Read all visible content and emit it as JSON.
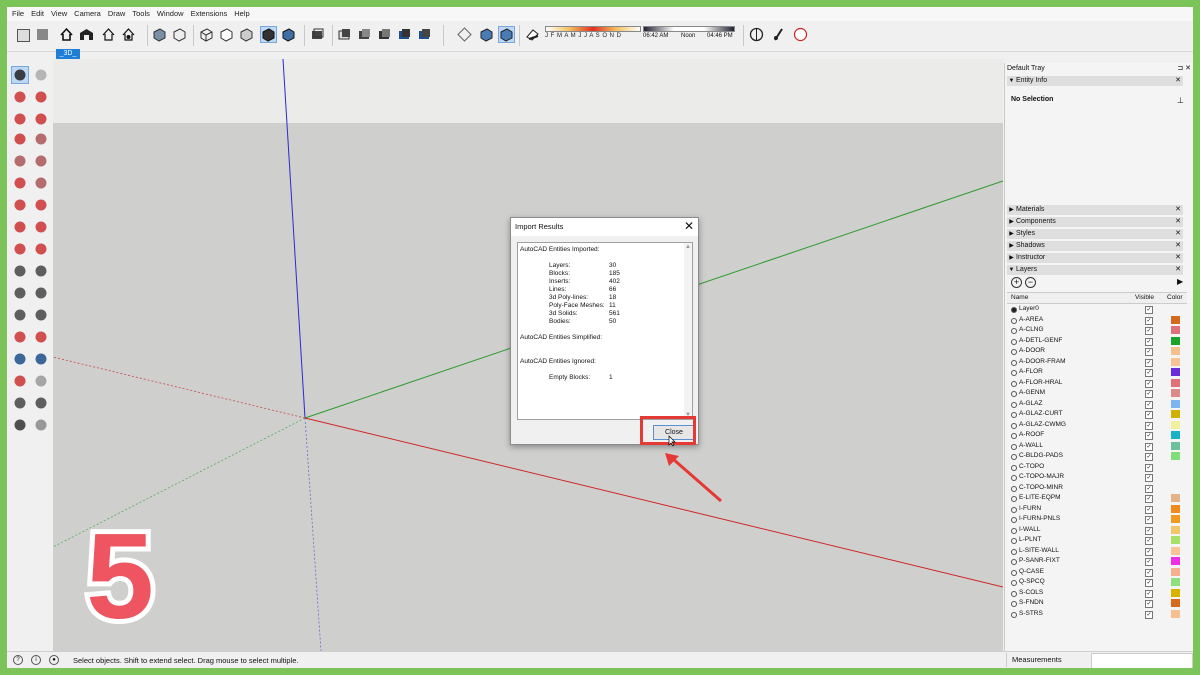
{
  "menu": [
    "File",
    "Edit",
    "View",
    "Camera",
    "Draw",
    "Tools",
    "Window",
    "Extensions",
    "Help"
  ],
  "shadow_months": "J F M A M J J A S O N D",
  "shadow_times": {
    "start": "06:42 AM",
    "mid": "Noon",
    "end": "04:46 PM"
  },
  "scene_tab": "_3D_",
  "dialog": {
    "title": "Import Results",
    "imported_heading": "AutoCAD Entities Imported:",
    "imported": [
      {
        "name": "Layers:",
        "value": "30"
      },
      {
        "name": "Blocks:",
        "value": "185"
      },
      {
        "name": "Inserts:",
        "value": "402"
      },
      {
        "name": "Lines:",
        "value": "66"
      },
      {
        "name": "3d Poly-lines:",
        "value": "18"
      },
      {
        "name": "Poly-Face Meshes:",
        "value": "11"
      },
      {
        "name": "3d Solids:",
        "value": "561"
      },
      {
        "name": "Bodies:",
        "value": "50"
      }
    ],
    "simplified_heading": "AutoCAD Entities Simplified:",
    "ignored_heading": "AutoCAD Entities Ignored:",
    "ignored": [
      {
        "name": "Empty Blocks:",
        "value": "1"
      }
    ],
    "close_label": "Close",
    "close_x": "✕"
  },
  "overlay_number": "5",
  "tray": {
    "title": "Default Tray",
    "entity_info_label": "Entity Info",
    "no_selection": "No Selection",
    "panels": [
      "Materials",
      "Components",
      "Styles",
      "Shadows",
      "Instructor"
    ],
    "layers_label": "Layers",
    "columns": {
      "name": "Name",
      "visible": "Visible",
      "color": "Color"
    },
    "layers": [
      {
        "name": "Layer0",
        "active": true,
        "color": ""
      },
      {
        "name": "A-AREA",
        "active": false,
        "color": "#d5691e"
      },
      {
        "name": "A-CLNG",
        "active": false,
        "color": "#e2707a"
      },
      {
        "name": "A-DETL-GENF",
        "active": false,
        "color": "#1aa32a"
      },
      {
        "name": "A-DOOR",
        "active": false,
        "color": "#f4c08c"
      },
      {
        "name": "A-DOOR-FRAM",
        "active": false,
        "color": "#f6c495"
      },
      {
        "name": "A-FLOR",
        "active": false,
        "color": "#6a2bd8"
      },
      {
        "name": "A-FLOR-HRAL",
        "active": false,
        "color": "#e07277"
      },
      {
        "name": "A-GENM",
        "active": false,
        "color": "#dc8a8a"
      },
      {
        "name": "A-GLAZ",
        "active": false,
        "color": "#7fb4ee"
      },
      {
        "name": "A-GLAZ-CURT",
        "active": false,
        "color": "#d1b100"
      },
      {
        "name": "A-GLAZ-CWMG",
        "active": false,
        "color": "#f3f09d"
      },
      {
        "name": "A-ROOF",
        "active": false,
        "color": "#17b3c4"
      },
      {
        "name": "A-WALL",
        "active": false,
        "color": "#6cc19b"
      },
      {
        "name": "C-BLDG-PADS",
        "active": false,
        "color": "#7ddf78"
      },
      {
        "name": "C-TOPO",
        "active": false,
        "color": ""
      },
      {
        "name": "C-TOPO-MAJR",
        "active": false,
        "color": ""
      },
      {
        "name": "C-TOPO-MINR",
        "active": false,
        "color": ""
      },
      {
        "name": "E-LITE-EQPM",
        "active": false,
        "color": "#e3b48b"
      },
      {
        "name": "I-FURN",
        "active": false,
        "color": "#f08a1e"
      },
      {
        "name": "I-FURN-PNLS",
        "active": false,
        "color": "#f09a20"
      },
      {
        "name": "I-WALL",
        "active": false,
        "color": "#f0c86a"
      },
      {
        "name": "L-PLNT",
        "active": false,
        "color": "#a9e06a"
      },
      {
        "name": "L-SITE-WALL",
        "active": false,
        "color": "#f6c495"
      },
      {
        "name": "P-SANR-FIXT",
        "active": false,
        "color": "#ee2fe6"
      },
      {
        "name": "Q-CASE",
        "active": false,
        "color": "#f6b090"
      },
      {
        "name": "Q-SPCQ",
        "active": false,
        "color": "#8ee07c"
      },
      {
        "name": "S-COLS",
        "active": false,
        "color": "#d9b200"
      },
      {
        "name": "S-FNDN",
        "active": false,
        "color": "#d66a1c"
      },
      {
        "name": "S-STRS",
        "active": false,
        "color": "#f6bf8e"
      }
    ]
  },
  "status": {
    "text": "Select objects. Shift to extend select. Drag mouse to select multiple.",
    "measurements": "Measurements"
  },
  "colors": {
    "highlight": "#e53935",
    "axis_red": "#d22",
    "axis_green": "#2a2",
    "axis_blue": "#22c",
    "frame": "#7cc35a"
  }
}
